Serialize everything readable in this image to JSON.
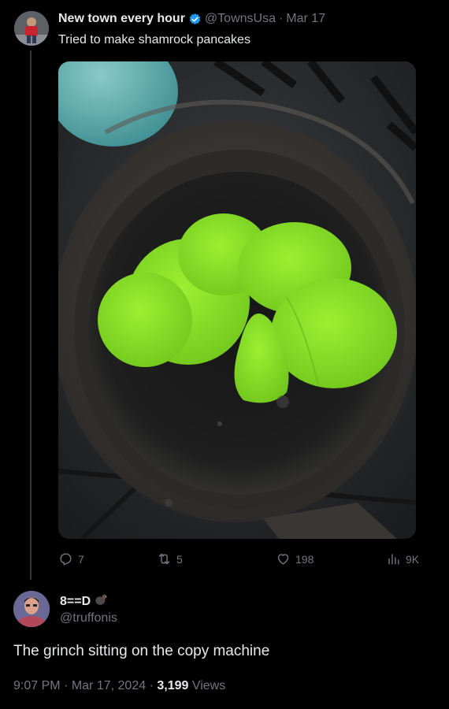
{
  "tweet": {
    "display_name": "New town every hour",
    "handle": "@TownsUsa",
    "separator": "·",
    "date": "Mar 17",
    "text": "Tried to make shamrock pancakes",
    "actions": {
      "replies": "7",
      "retweets": "5",
      "likes": "198",
      "views": "9K"
    }
  },
  "reply": {
    "display_name": "8==D",
    "handle": "@truffonis",
    "text": "The grinch sitting on the copy machine",
    "time": "9:07 PM",
    "sep1": "·",
    "date": "Mar 17, 2024",
    "sep2": "·",
    "views_count": "3,199",
    "views_label": "Views"
  },
  "colors": {
    "background": "#000000",
    "text_primary": "#e7e9ea",
    "text_muted": "#71767b",
    "verified_blue": "#1d9bf0",
    "pancake_green": "#8ee024"
  },
  "icons": {
    "verified": "verified-badge-icon",
    "reply": "reply-icon",
    "retweet": "retweet-icon",
    "like": "heart-icon",
    "views": "views-chart-icon",
    "emoji": "turkey-emoji-icon"
  }
}
